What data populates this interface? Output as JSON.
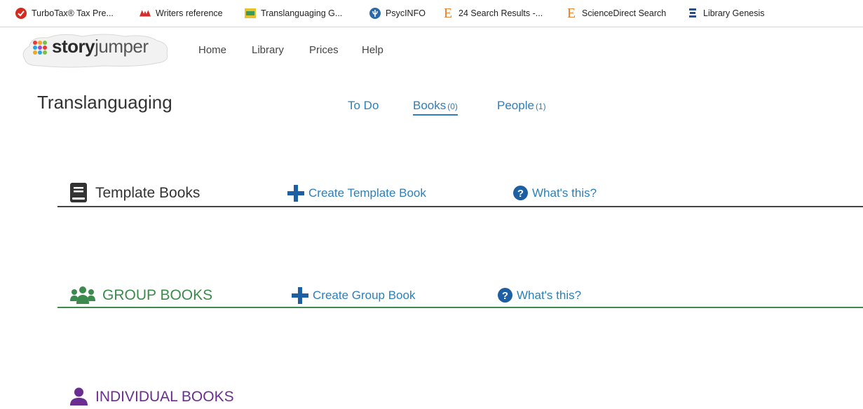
{
  "bookmarks": [
    {
      "label": "TurboTax® Tax Pre...",
      "icon": "turbotax-check-icon"
    },
    {
      "label": "Writers reference",
      "icon": "writers-reference-icon"
    },
    {
      "label": "Translanguaging G...",
      "icon": "translanguaging-icon"
    },
    {
      "label": "PsycINFO",
      "icon": "psycinfo-icon"
    },
    {
      "label": "24 Search Results -...",
      "icon": "elsevier-e-icon"
    },
    {
      "label": "ScienceDirect Search",
      "icon": "elsevier-e-icon"
    },
    {
      "label": "Library Genesis",
      "icon": "library-genesis-icon"
    }
  ],
  "header": {
    "logo_story": "story",
    "logo_jumper": "jumper",
    "nav": [
      "Home",
      "Library",
      "Prices",
      "Help"
    ]
  },
  "class": {
    "title": "Translanguaging",
    "tabs": [
      {
        "label": "To Do",
        "count": ""
      },
      {
        "label": "Books",
        "count": "(0)"
      },
      {
        "label": "People",
        "count": "(1)"
      }
    ]
  },
  "sections": {
    "template": {
      "title": "Template Books",
      "action": "Create Template Book",
      "help": "What's this?",
      "color": "#333333"
    },
    "group": {
      "title": "GROUP BOOKS",
      "action": "Create Group Book",
      "help": "What's this?",
      "color": "#3c8a4e"
    },
    "individual": {
      "title": "INDIVIDUAL BOOKS",
      "color": "#6a2e91"
    }
  },
  "colors": {
    "link": "#2c7fb8",
    "plus": "#1e5fa3"
  }
}
